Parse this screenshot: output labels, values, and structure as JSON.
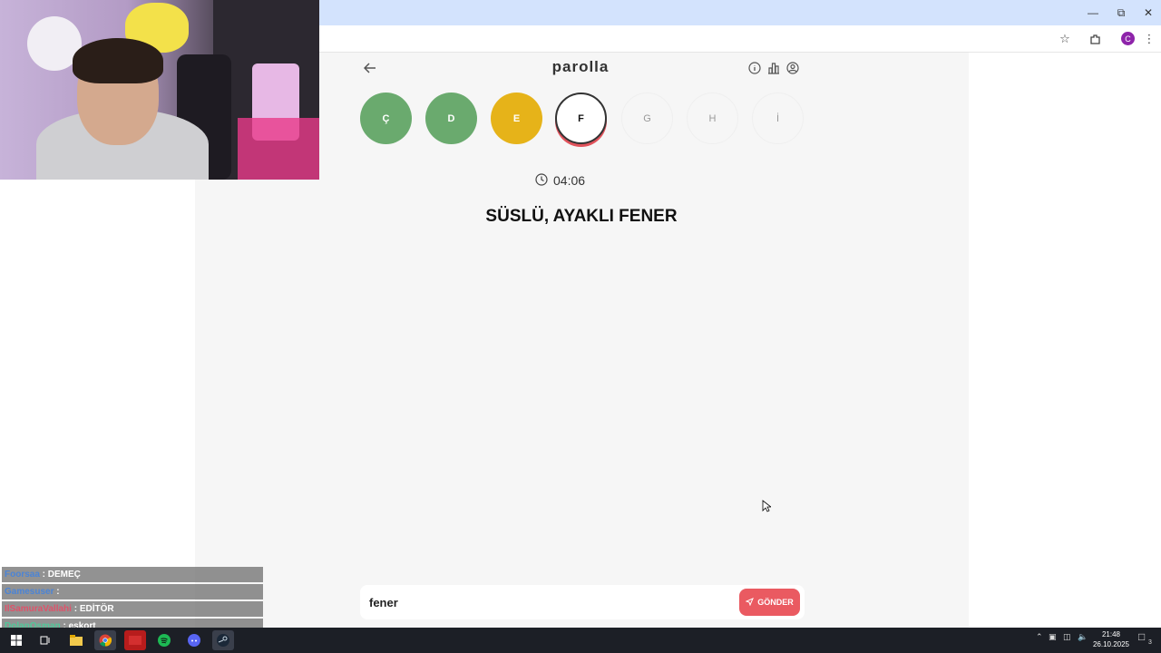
{
  "browser": {
    "profile_initial": "C",
    "accent": "#d3e3fd"
  },
  "app": {
    "title": "parolla",
    "letters": [
      {
        "char": "Ç",
        "state": "correct"
      },
      {
        "char": "D",
        "state": "correct"
      },
      {
        "char": "E",
        "state": "skipped"
      },
      {
        "char": "F",
        "state": "active"
      },
      {
        "char": "G",
        "state": "pending"
      },
      {
        "char": "H",
        "state": "pending"
      },
      {
        "char": "İ",
        "state": "pending"
      }
    ],
    "timer": "04:06",
    "clue": "SÜSLÜ, AYAKLI FENER",
    "answer_value": "fener",
    "send_label": "GÖNDER",
    "colors": {
      "correct": "#6aaa6e",
      "skipped": "#e6b319",
      "send": "#ea5a61"
    }
  },
  "chat": [
    {
      "user": "Foorsaa",
      "message": " : DEMEÇ"
    },
    {
      "user": "Gamesuser",
      "message": " : "
    },
    {
      "user": "IlSamuraVallahi",
      "message": " : EDİTÖR"
    },
    {
      "user": "DolapOsman",
      "message": " : eskort"
    }
  ],
  "taskbar": {
    "time": "21:48",
    "date": "26.10.2025",
    "notification_count": "3"
  }
}
